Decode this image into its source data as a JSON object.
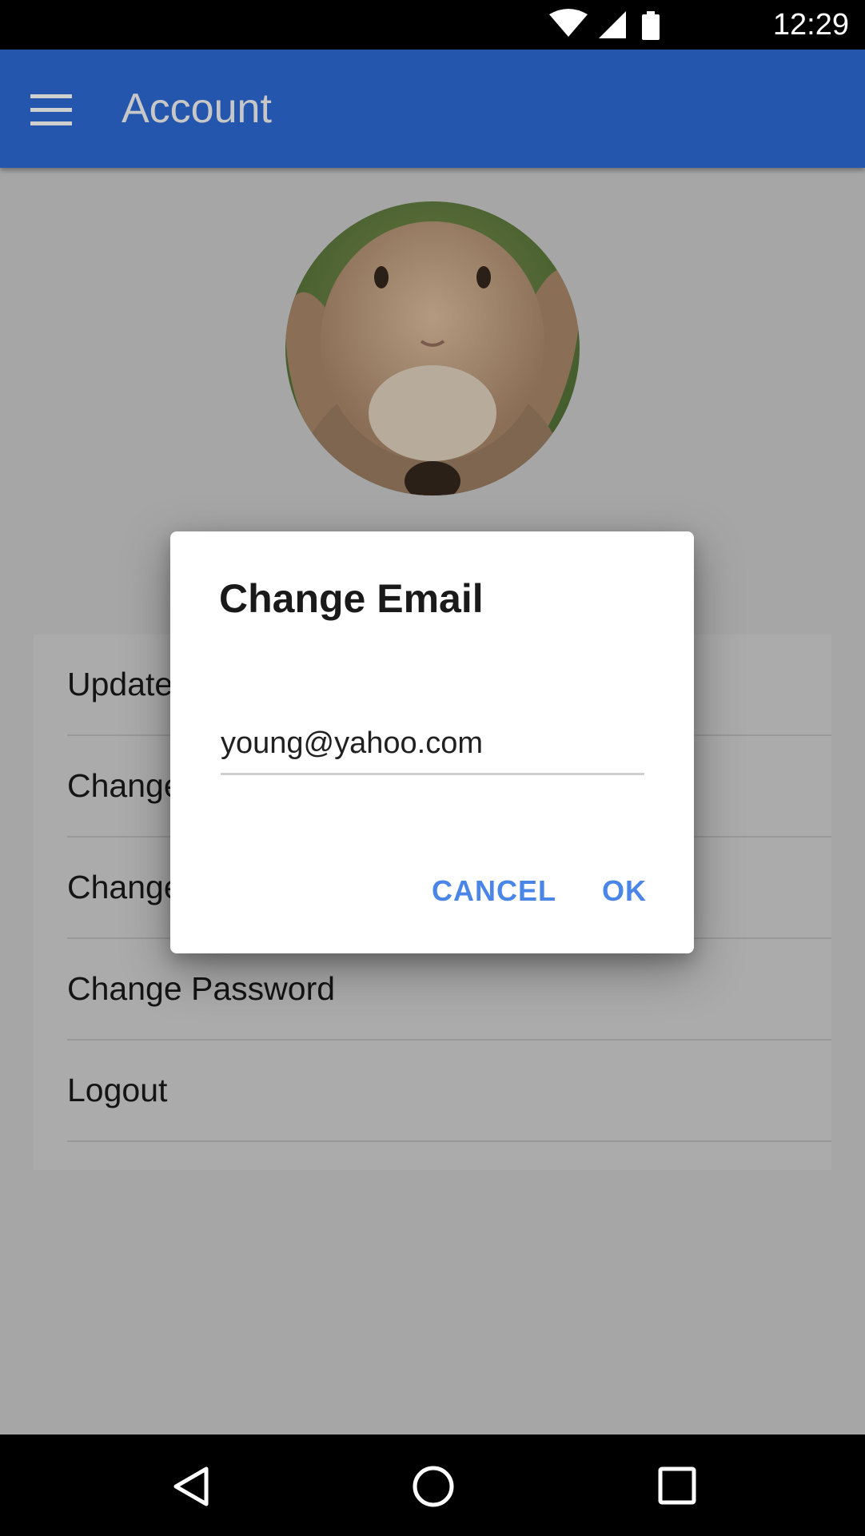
{
  "status_bar": {
    "time": "12:29",
    "icons": [
      "wifi-icon",
      "signal-icon",
      "battery-icon"
    ]
  },
  "app_bar": {
    "title": "Account",
    "menu_icon": "menu-icon",
    "color": "#2556ad"
  },
  "profile": {
    "avatar_description": "rabbit-photo"
  },
  "menu_items": [
    {
      "label": "Update"
    },
    {
      "label": "Change"
    },
    {
      "label": "Change"
    },
    {
      "label": "Change Password"
    },
    {
      "label": "Logout"
    }
  ],
  "dialog": {
    "title": "Change Email",
    "email_value": "young@yahoo.com",
    "cancel_label": "CANCEL",
    "ok_label": "OK",
    "accent_color": "#4a86e8"
  },
  "nav_bar": {
    "buttons": [
      "back-icon",
      "home-icon",
      "recents-icon"
    ]
  }
}
